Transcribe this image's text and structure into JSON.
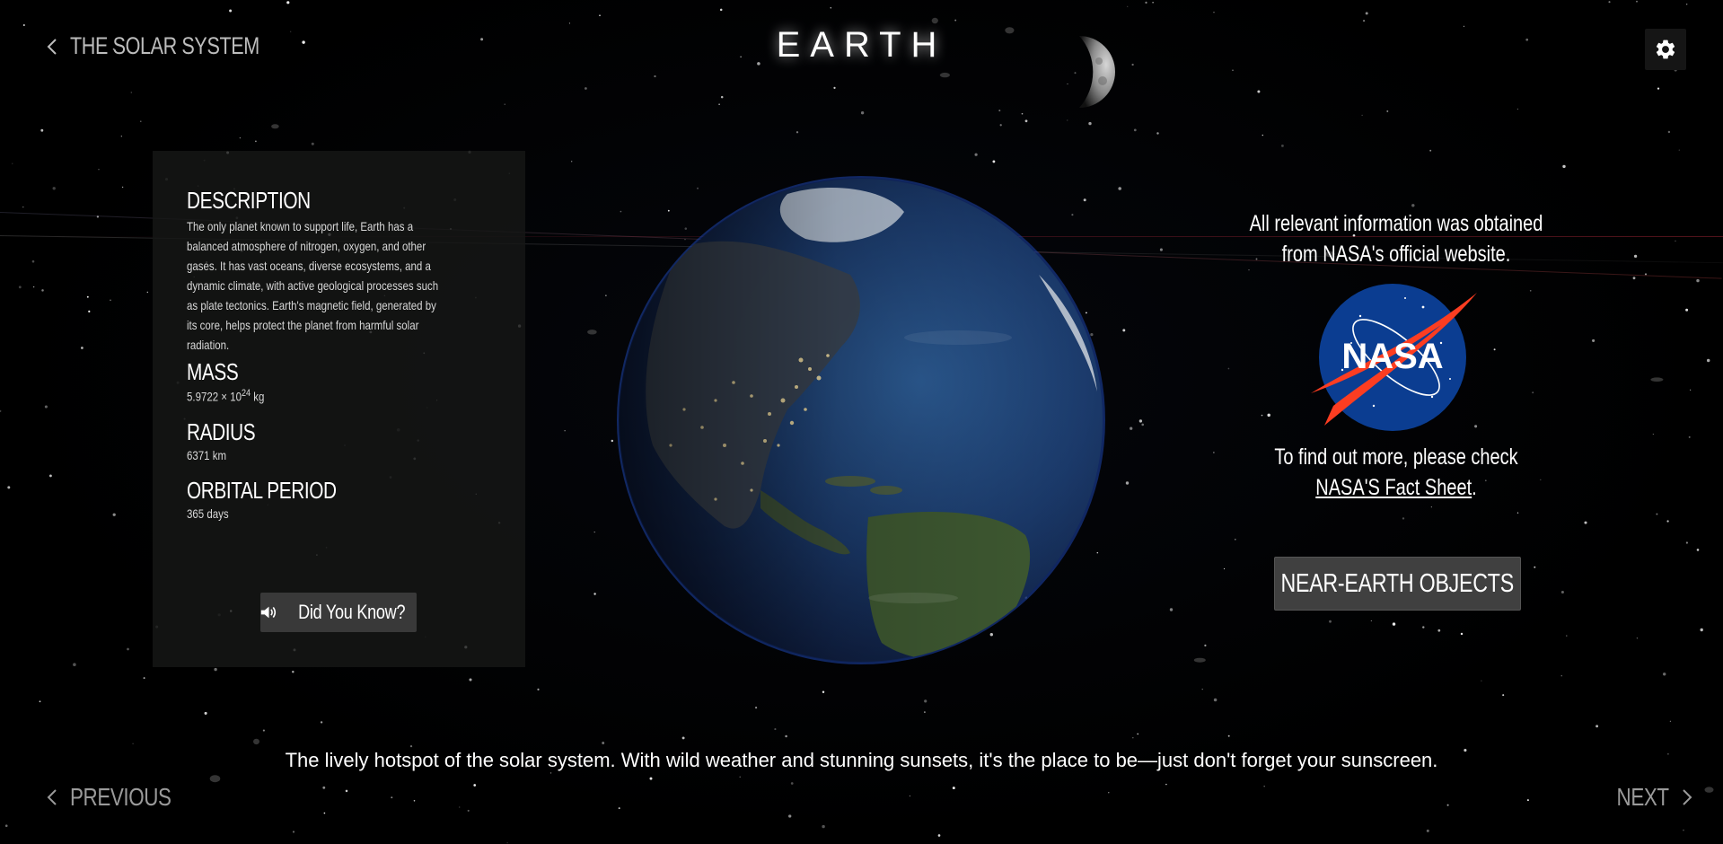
{
  "header": {
    "back_label": "THE SOLAR SYSTEM",
    "title": "EARTH"
  },
  "info": {
    "description_title": "DESCRIPTION",
    "description_lines": [
      "The only planet known to support life, Earth has a",
      "balanced atmosphere of nitrogen, oxygen, and other",
      "gases. It has vast oceans, diverse ecosystems, and a",
      "dynamic climate, with active geological processes such",
      "as plate tectonics. Earth's magnetic field, generated by",
      "its core, helps protect the planet from harmful solar",
      "radiation."
    ],
    "mass_title": "MASS",
    "mass_base": "5.9722 × 10",
    "mass_exp": "24",
    "mass_unit": " kg",
    "radius_title": "RADIUS",
    "radius_value": "6371 km",
    "period_title": "ORBITAL PERIOD",
    "period_value": "365 days",
    "did_you_know_label": "Did You Know?"
  },
  "source": {
    "line1": "All relevant information was obtained",
    "line2": "from NASA's official website.",
    "logo_text": "NASA",
    "more_line1": "To find out more, please check",
    "fact_sheet_link": "NASA'S Fact Sheet",
    "fact_sheet_suffix": ".",
    "neo_button": "NEAR-EARTH OBJECTS"
  },
  "tagline": "The lively hotspot of the solar system. With wild weather and stunning sunsets, it's the place to be—just don't forget your sunscreen.",
  "nav": {
    "previous_label": "PREVIOUS",
    "next_label": "NEXT"
  },
  "icons": {
    "back": "chevron-left-icon",
    "settings": "gear-icon",
    "speaker": "speaker-icon",
    "previous": "chevron-left-icon",
    "next": "chevron-right-icon"
  }
}
